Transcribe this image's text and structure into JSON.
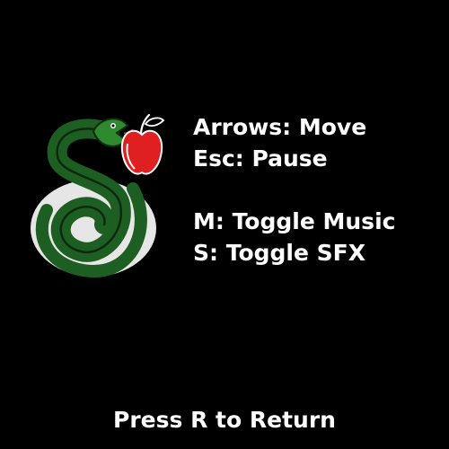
{
  "screen": "controls",
  "colors": {
    "background": "#000000",
    "text": "#ffffff",
    "snake": "#1d5e22",
    "snake_highlight": "#2f8a2f",
    "apple": "#e02020",
    "disc": "#e6e6e6"
  },
  "logo": {
    "icons": [
      "snake-icon",
      "apple-icon",
      "disc-icon"
    ]
  },
  "controls": {
    "move": "Arrows: Move",
    "pause": "Esc: Pause",
    "music": "M: Toggle Music",
    "sfx": "S: Toggle SFX"
  },
  "footer": {
    "prompt": "Press R to Return"
  }
}
